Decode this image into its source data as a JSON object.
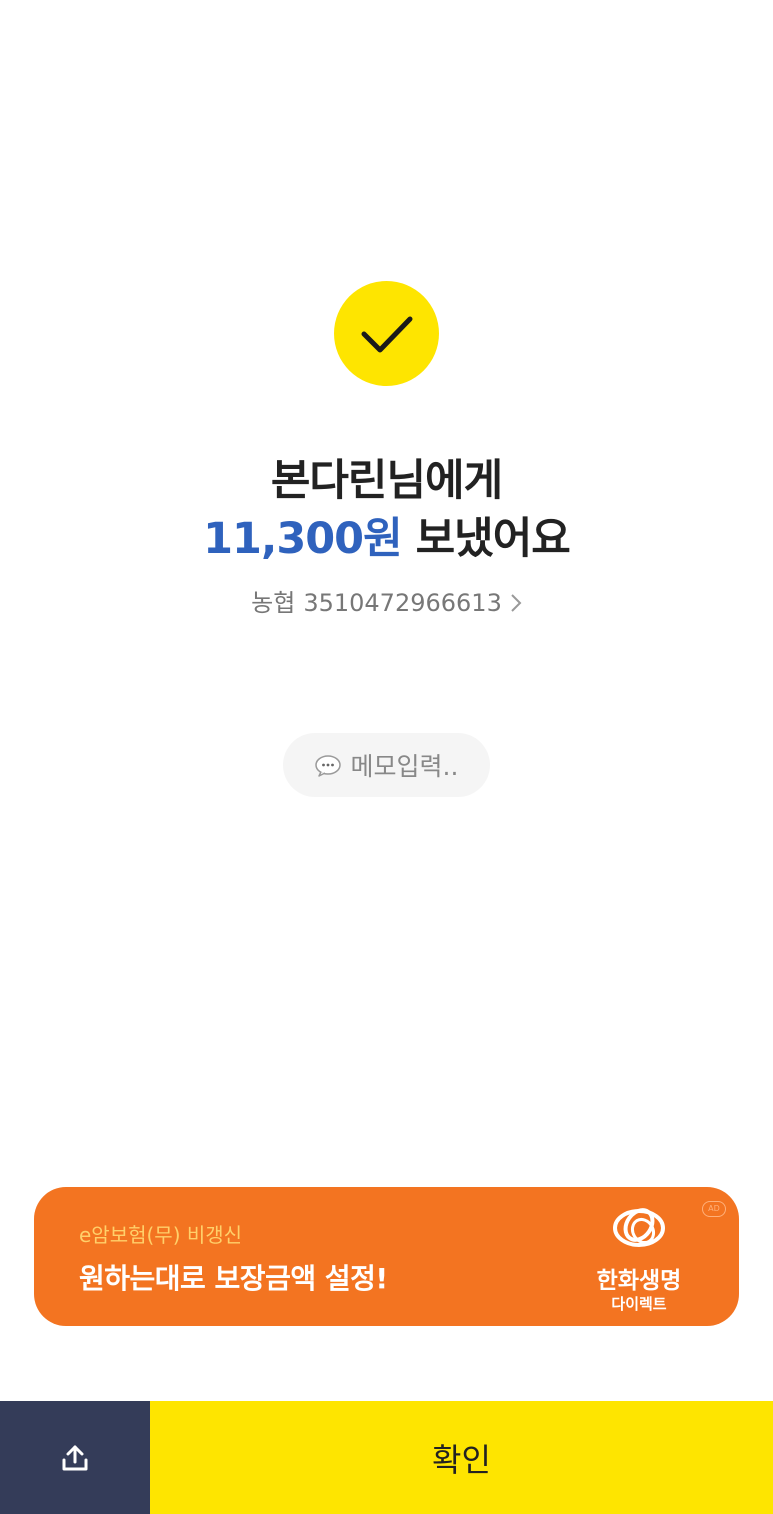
{
  "result": {
    "title_line1": "본다린님에게",
    "amount": "11,300원",
    "title_line2_suffix": " 보냈어요",
    "bank": "농협",
    "account_number": "3510472966613",
    "check_icon": "check-icon",
    "accent_color": "#fee500",
    "amount_color": "#2f62bd"
  },
  "memo": {
    "icon": "speech-bubble-icon",
    "placeholder": "메모입력.."
  },
  "ad": {
    "subtitle": "e암보험(무) 비갱신",
    "headline": "원하는대로 보장금액 설정!",
    "brand": "한화생명",
    "brand_sub": "다이렉트",
    "badge": "AD",
    "background": "#f37421"
  },
  "bottom": {
    "share_icon": "share-upload-icon",
    "confirm_label": "확인"
  }
}
